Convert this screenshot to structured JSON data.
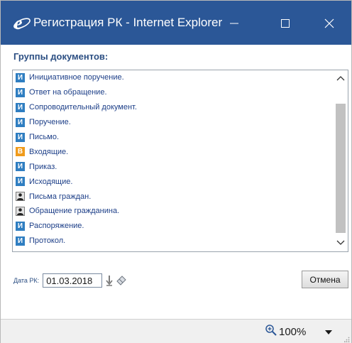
{
  "window": {
    "title": "Регистрация РК - Internet Explorer",
    "titlebar_color": "#2b5797"
  },
  "main": {
    "group_title": "Группы документов:",
    "documents": [
      {
        "label": "Инициативное поручение.",
        "icon": "document-type-icon",
        "badge": "И"
      },
      {
        "label": "Ответ на обращение.",
        "icon": "document-type-icon",
        "badge": "И"
      },
      {
        "label": "Сопроводительный документ.",
        "icon": "document-type-icon",
        "badge": "И"
      },
      {
        "label": "Поручение.",
        "icon": "document-type-icon",
        "badge": "И"
      },
      {
        "label": "Письмо.",
        "icon": "document-type-icon",
        "badge": "И"
      },
      {
        "label": "Входящие.",
        "icon": "incoming-document-icon",
        "badge": "В"
      },
      {
        "label": "Приказ.",
        "icon": "document-type-icon",
        "badge": "И"
      },
      {
        "label": "Исходящие.",
        "icon": "document-type-icon",
        "badge": "И"
      },
      {
        "label": "Письма граждан.",
        "icon": "citizen-icon",
        "badge": ""
      },
      {
        "label": "Обращение гражданина.",
        "icon": "citizen-icon",
        "badge": ""
      },
      {
        "label": "Распоряжение.",
        "icon": "document-type-icon",
        "badge": "И"
      },
      {
        "label": "Протокол.",
        "icon": "document-type-icon",
        "badge": "И"
      }
    ]
  },
  "date_field": {
    "label": "Дата РК:",
    "value": "01.03.2018"
  },
  "buttons": {
    "cancel": "Отмена"
  },
  "statusbar": {
    "zoom": "100%"
  },
  "colors": {
    "accent": "#2b5797",
    "label_blue": "#2c4f83",
    "doc_icon": "#2f7ec1",
    "incoming_icon": "#f09b1b"
  }
}
